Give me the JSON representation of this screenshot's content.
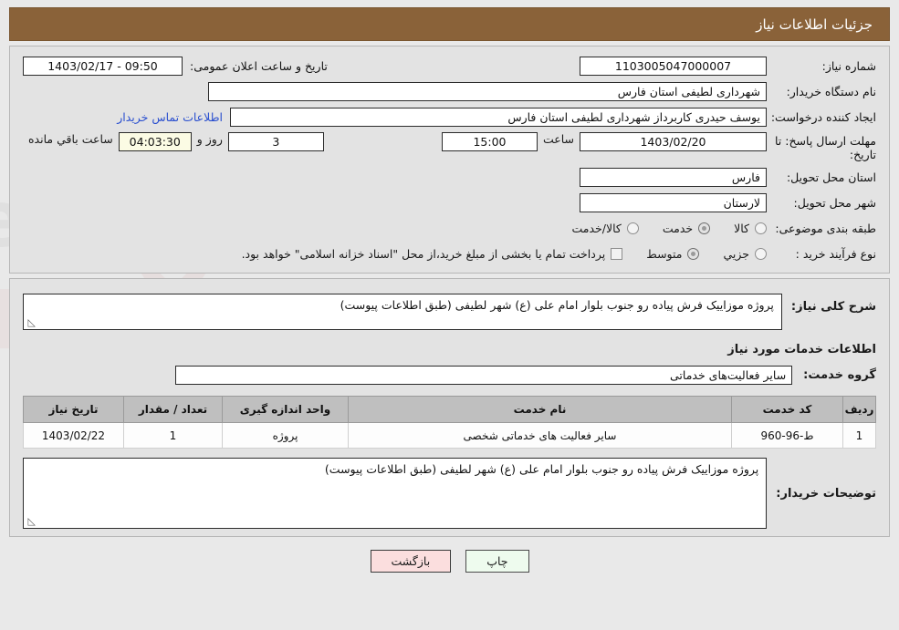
{
  "header": {
    "title": "جزئیات اطلاعات نیاز",
    "bar_color": "#8a6239"
  },
  "info": {
    "need_number_label": "شماره نیاز:",
    "need_number_value": "1103005047000007",
    "announce_label": "تاریخ و ساعت اعلان عمومی:",
    "announce_value": "09:50 - 1403/02/17",
    "buyer_org_label": "نام دستگاه خریدار:",
    "buyer_org_value": "شهرداری لطیفی استان فارس",
    "creator_label": "ایجاد کننده درخواست:",
    "creator_value": "یوسف حیدری کاربرداز شهرداری لطیفی استان فارس",
    "contact_link": "اطلاعات تماس خریدار",
    "deadline_label": "مهلت ارسال پاسخ: تا تاریخ:",
    "deadline_value": "1403/02/20",
    "time_label": "ساعت",
    "time_value": "15:00",
    "days_value": "3",
    "days_unit": "روز و",
    "remaining_value": "04:03:30",
    "remaining_unit": "ساعت باقي مانده",
    "province_label": "استان محل تحویل:",
    "province_value": "فارس",
    "city_label": "شهر محل تحویل:",
    "city_value": "لارستان",
    "category_label": "طبقه بندی موضوعی:",
    "category_options": [
      {
        "label": "کالا",
        "checked": false
      },
      {
        "label": "خدمت",
        "checked": true
      },
      {
        "label": "کالا/خدمت",
        "checked": false
      }
    ],
    "process_label": "نوع فرآیند خرید :",
    "process_options": [
      {
        "label": "جزیي",
        "checked": false
      },
      {
        "label": "متوسط",
        "checked": true
      }
    ],
    "treasury_checkbox_label": "پرداخت تمام یا بخشی از مبلغ خرید،از محل \"اسناد خزانه اسلامی\" خواهد بود.",
    "treasury_checked": false
  },
  "need": {
    "summary_label": "شرح کلی نیاز:",
    "summary_value": "پروژه موزاییک فرش پیاده رو جنوب بلوار امام علی (ع) شهر لطیفی (طبق اطلاعات پیوست)",
    "services_section_title": "اطلاعات خدمات مورد نیاز",
    "service_group_label": "گروه خدمت:",
    "service_group_value": "سایر فعالیت‌های خدماتی"
  },
  "table": {
    "columns": [
      "ردیف",
      "کد خدمت",
      "نام خدمت",
      "واحد اندازه گیری",
      "تعداد / مقدار",
      "تاریخ نیاز"
    ],
    "rows": [
      {
        "row_no": "1",
        "service_code": "ط-96-960",
        "service_name": "سایر فعالیت های خدماتی شخصی",
        "unit": "پروژه",
        "quantity": "1",
        "need_date": "1403/02/22"
      }
    ]
  },
  "buyer_notes": {
    "label": "توضیحات خریدار:",
    "value": "پروژه موزاییک فرش پیاده رو جنوب بلوار امام علی (ع) شهر لطیفی (طبق اطلاعات پیوست)"
  },
  "footer": {
    "print_label": "چاپ",
    "back_label": "بازگشت"
  },
  "watermark": {
    "text": "AriaTender.net"
  }
}
